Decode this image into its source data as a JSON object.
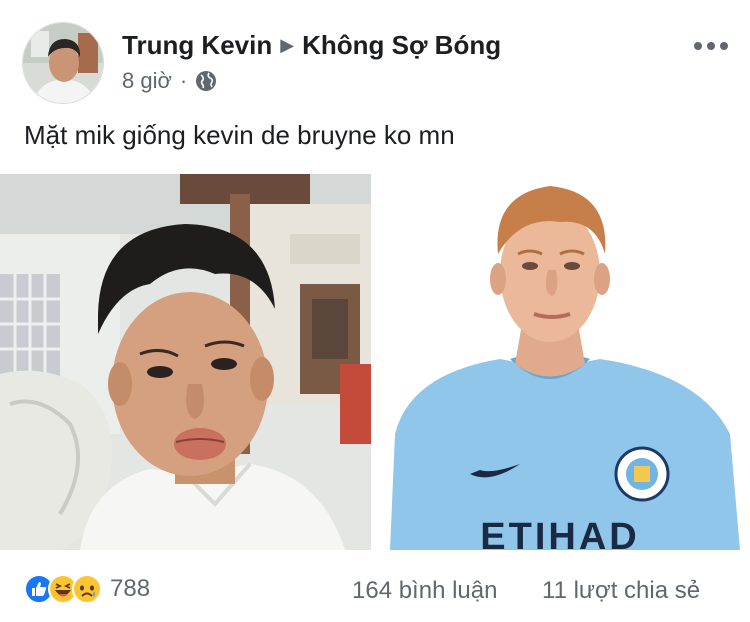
{
  "post": {
    "author": "Trung Kevin",
    "group": "Không Sợ Bóng",
    "time": "8 giờ",
    "separator": "·",
    "caption": "Mặt mik giống kevin de bruyne ko mn",
    "icons": {
      "share_arrow": "triangle-right-icon",
      "privacy": "globe-icon",
      "more": "more-options-icon"
    }
  },
  "photos": {
    "right_shirt_text": "ETIHAD"
  },
  "footer": {
    "reactions": [
      "like-icon",
      "haha-icon",
      "sad-icon"
    ],
    "reaction_count": "788",
    "comments": "164 bình luận",
    "shares": "11 lượt chia sẻ"
  },
  "colors": {
    "text": "#1c1e21",
    "muted": "#606770",
    "like_blue": "#1877f2",
    "emoji_yellow": "#fcc430",
    "shirt_blue": "#8fc6ea"
  }
}
